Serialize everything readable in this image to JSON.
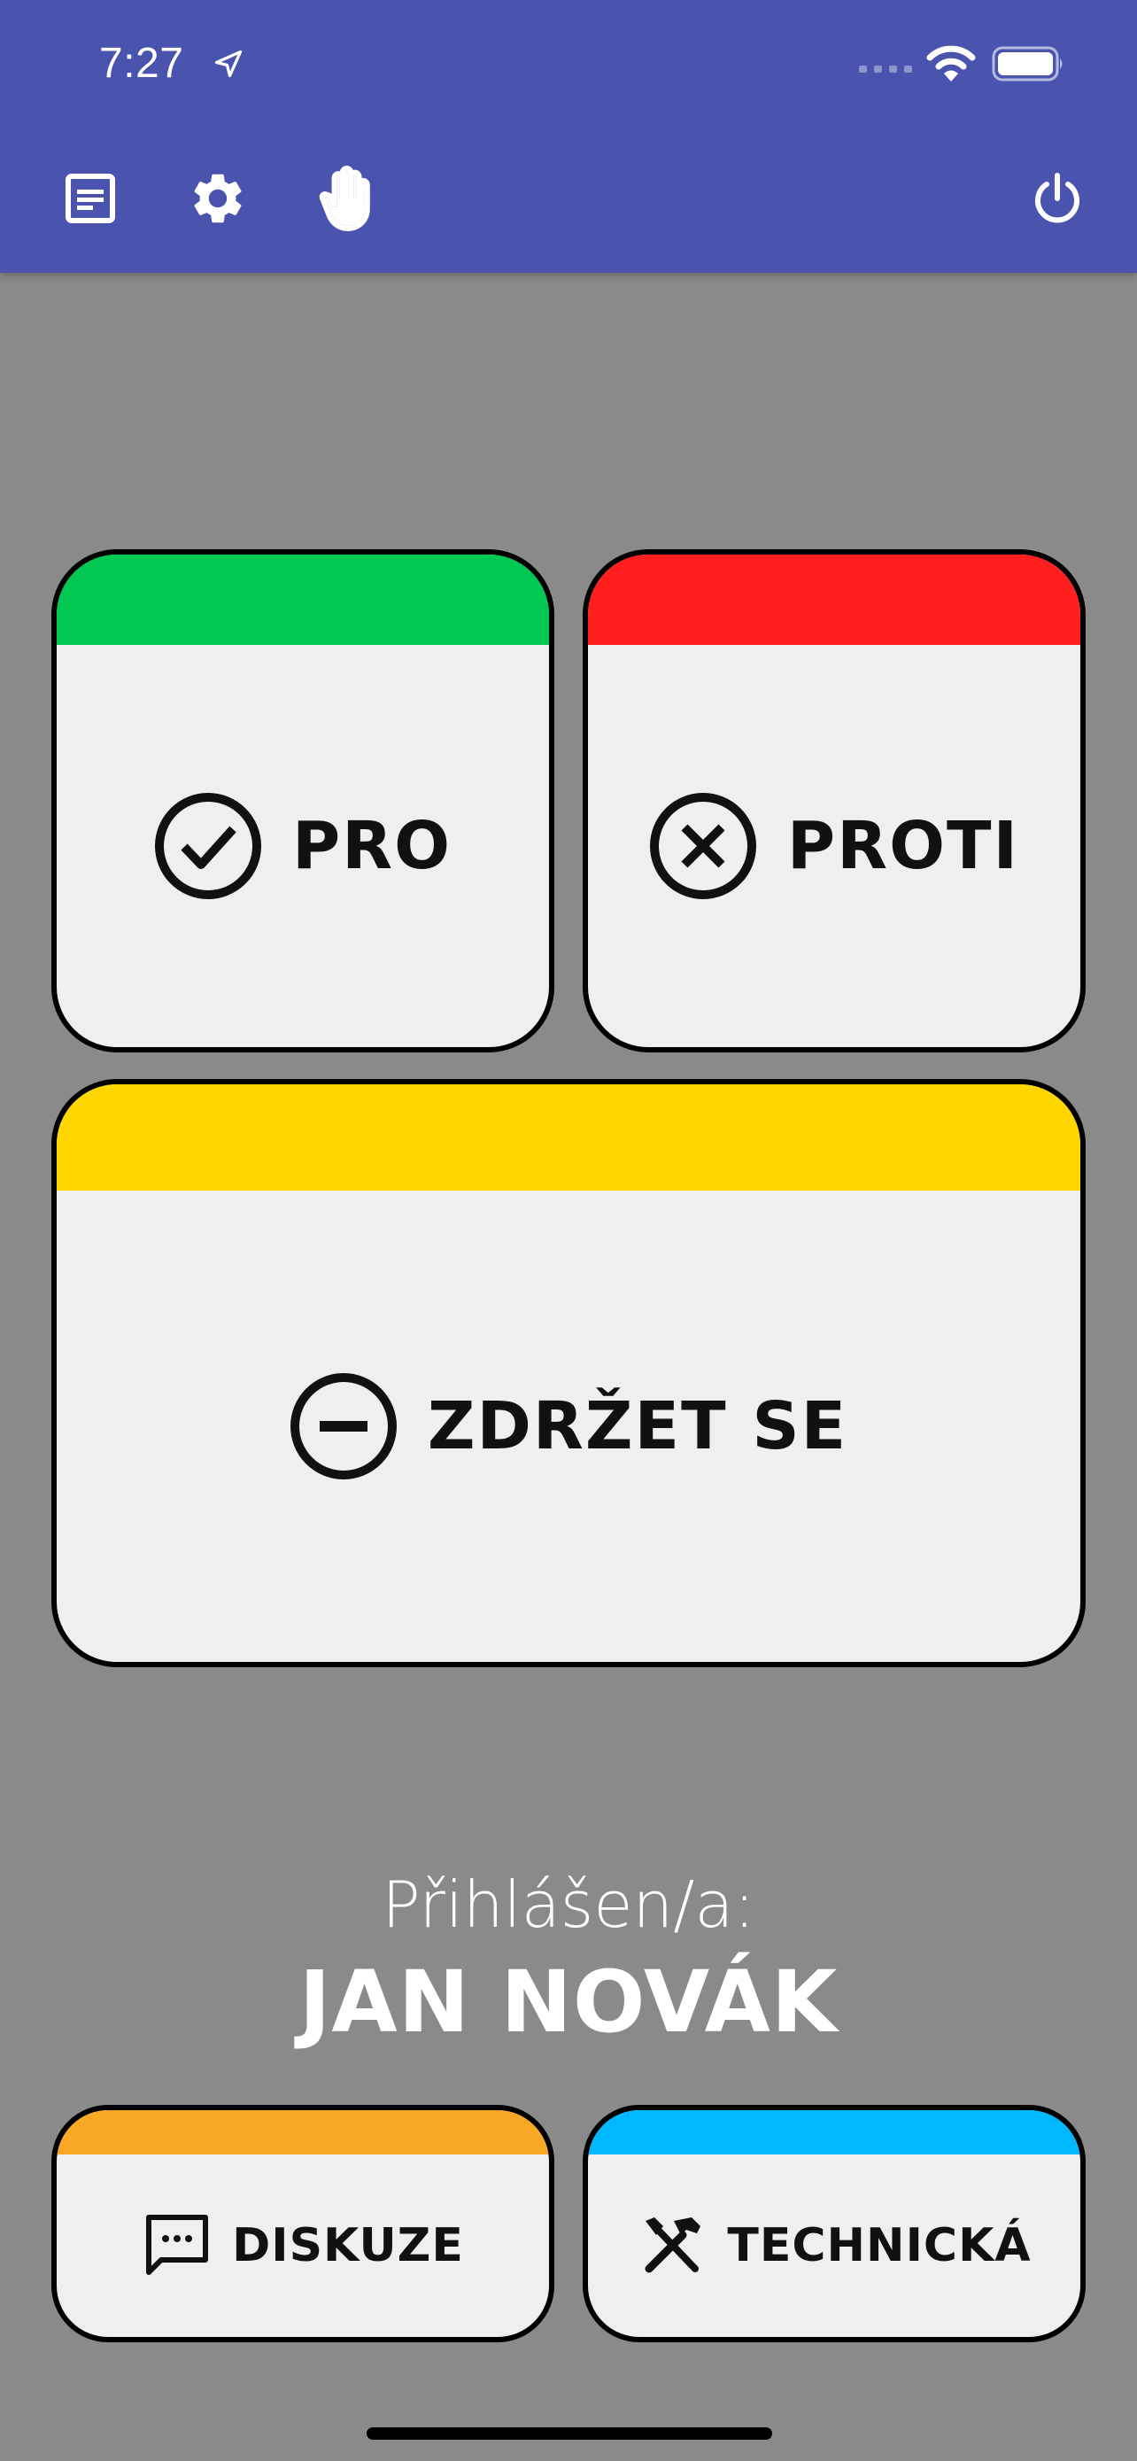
{
  "status_bar": {
    "time": "7:27"
  },
  "toolbar": {
    "icons": [
      "notes-icon",
      "gear-icon",
      "raise-hand-icon",
      "power-icon"
    ]
  },
  "votes": {
    "pro": {
      "label": "PRO",
      "color": "#00c853"
    },
    "proti": {
      "label": "PROTI",
      "color": "#ff1f1f"
    },
    "zdrzet": {
      "label": "ZDRŽET SE",
      "color": "#ffd600"
    }
  },
  "login": {
    "label": "Přihlášen/a:",
    "name": "JAN NOVÁK"
  },
  "requests": {
    "diskuze": {
      "label": "DISKUZE",
      "color": "#f9a825"
    },
    "technicka": {
      "label": "TECHNICKÁ",
      "color": "#00b8ff"
    }
  },
  "colors": {
    "app_bar": "#4a53ad",
    "background": "#8a8a8a",
    "card": "#efefef"
  }
}
